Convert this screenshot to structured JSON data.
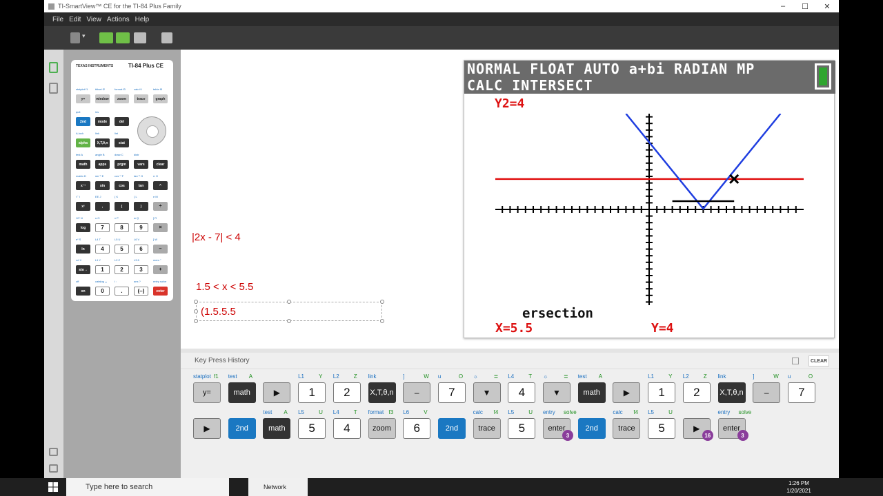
{
  "window": {
    "title": "TI-SmartView™ CE for the TI-84 Plus Family",
    "controls": [
      "–",
      "☐",
      "✕"
    ]
  },
  "menu": [
    "File",
    "Edit",
    "View",
    "Actions",
    "Help"
  ],
  "calculator": {
    "brand": "TEXAS INSTRUMENTS",
    "model": "TI-84 Plus CE",
    "rows": [
      [
        [
          "y=",
          "g"
        ],
        [
          "window",
          "g"
        ],
        [
          "zoom",
          "g"
        ],
        [
          "trace",
          "g"
        ],
        [
          "graph",
          "g"
        ]
      ],
      [
        [
          "2nd",
          "b"
        ],
        [
          "mode",
          "d"
        ],
        [
          "del",
          "d"
        ]
      ],
      [
        [
          "alpha",
          "gr"
        ],
        [
          "X,T,θ,n",
          "d"
        ],
        [
          "stat",
          "d"
        ]
      ],
      [
        [
          "math",
          "d"
        ],
        [
          "apps",
          "d"
        ],
        [
          "prgm",
          "d"
        ],
        [
          "vars",
          "d"
        ],
        [
          "clear",
          "d"
        ]
      ],
      [
        [
          "x⁻¹",
          "d"
        ],
        [
          "sin",
          "d"
        ],
        [
          "cos",
          "d"
        ],
        [
          "tan",
          "d"
        ],
        [
          "^",
          "d"
        ]
      ],
      [
        [
          "x²",
          "d"
        ],
        [
          ",",
          "d"
        ],
        [
          "(",
          "d"
        ],
        [
          ")",
          "d"
        ],
        [
          "÷",
          "mg"
        ]
      ],
      [
        [
          "log",
          "d"
        ],
        [
          "7",
          "w"
        ],
        [
          "8",
          "w"
        ],
        [
          "9",
          "w"
        ],
        [
          "×",
          "mg"
        ]
      ],
      [
        [
          "ln",
          "d"
        ],
        [
          "4",
          "w"
        ],
        [
          "5",
          "w"
        ],
        [
          "6",
          "w"
        ],
        [
          "–",
          "mg"
        ]
      ],
      [
        [
          "sto→",
          "d"
        ],
        [
          "1",
          "w"
        ],
        [
          "2",
          "w"
        ],
        [
          "3",
          "w"
        ],
        [
          "+",
          "mg"
        ]
      ],
      [
        [
          "on",
          "d"
        ],
        [
          "0",
          "w"
        ],
        [
          ".",
          "w"
        ],
        [
          "(–)",
          "w"
        ],
        [
          "enter",
          "r"
        ]
      ]
    ],
    "labels": [
      "statplot f1",
      "tblset f2",
      "format f3",
      "calc f4",
      "table f5",
      "quit",
      "ins",
      "A-lock",
      "link",
      "list",
      "test A",
      "angle B",
      "draw C",
      "distr",
      "matrix D",
      "sin⁻¹ E",
      "cos⁻¹ F",
      "tan⁻¹ G",
      "π H",
      "√‾ I",
      "EE J",
      "{ K",
      "} L",
      "e M",
      "10ˣ N",
      "u O",
      "v P",
      "w Q",
      "[ R",
      "eˣ S",
      "L4 T",
      "L5 U",
      "L6 V",
      "] W",
      "rcl X",
      "L1 Y",
      "L2 Z",
      "L3 θ",
      "mem \"",
      "off",
      "catalog ⌴",
      "i :",
      "ans ?",
      "entry solve"
    ]
  },
  "screen": {
    "line1": "NORMAL FLOAT AUTO a+bi RADIAN MP",
    "line2": "CALC INTERSECT",
    "y2": "Y2=4",
    "intersection": "ersection",
    "x": "X=5.5",
    "y": "Y=4"
  },
  "graph_colors": {
    "absolute_line": "#1f3ee0",
    "constant_line": "#e01010",
    "axes": "#000000"
  },
  "notes": {
    "inequality": "|2x - 7| < 4",
    "solution": "1.5 < x < 5.5",
    "textbox": "(1.5.5.5"
  },
  "history": {
    "title": "Key Press History",
    "clear": "CLEAR",
    "row1": [
      {
        "key": "y=",
        "t": "g",
        "top": "statplot",
        "topr": "f1"
      },
      {
        "key": "math",
        "t": "d",
        "top": "test",
        "topr": "A"
      },
      {
        "key": "▶",
        "t": "a",
        "top": "",
        "topr": ""
      },
      {
        "key": "1",
        "t": "w",
        "top": "L1",
        "topr": "Y"
      },
      {
        "key": "2",
        "t": "w",
        "top": "L2",
        "topr": "Z"
      },
      {
        "key": "X,T,θ,n",
        "t": "d",
        "top": "link",
        "topr": ""
      },
      {
        "key": "–",
        "t": "a",
        "top": "]",
        "topr": "W"
      },
      {
        "key": "7",
        "t": "w",
        "top": "u",
        "topr": "O"
      },
      {
        "key": "▼",
        "t": "a",
        "top": "☼",
        "topr": "≣"
      },
      {
        "key": "4",
        "t": "w",
        "top": "L4",
        "topr": "T"
      },
      {
        "key": "▼",
        "t": "a",
        "top": "☼",
        "topr": "≣"
      },
      {
        "key": "math",
        "t": "d",
        "top": "test",
        "topr": "A"
      },
      {
        "key": "▶",
        "t": "a",
        "top": "",
        "topr": ""
      },
      {
        "key": "1",
        "t": "w",
        "top": "L1",
        "topr": "Y"
      },
      {
        "key": "2",
        "t": "w",
        "top": "L2",
        "topr": "Z"
      },
      {
        "key": "X,T,θ,n",
        "t": "d",
        "top": "link",
        "topr": ""
      },
      {
        "key": "–",
        "t": "a",
        "top": "]",
        "topr": "W"
      },
      {
        "key": "7",
        "t": "w",
        "top": "u",
        "topr": "O"
      }
    ],
    "row2": [
      {
        "key": "▶",
        "t": "a",
        "top": "",
        "topr": ""
      },
      {
        "key": "2nd",
        "t": "b",
        "top": "",
        "topr": ""
      },
      {
        "key": "math",
        "t": "d",
        "top": "test",
        "topr": "A"
      },
      {
        "key": "5",
        "t": "w",
        "top": "L5",
        "topr": "U"
      },
      {
        "key": "4",
        "t": "w",
        "top": "L4",
        "topr": "T"
      },
      {
        "key": "zoom",
        "t": "g",
        "top": "format",
        "topr": "f3"
      },
      {
        "key": "6",
        "t": "w",
        "top": "L6",
        "topr": "V"
      },
      {
        "key": "2nd",
        "t": "b",
        "top": "",
        "topr": ""
      },
      {
        "key": "trace",
        "t": "g",
        "top": "calc",
        "topr": "f4"
      },
      {
        "key": "5",
        "t": "w",
        "top": "L5",
        "topr": "U"
      },
      {
        "key": "enter",
        "t": "g",
        "top": "entry",
        "topr": "solve",
        "badge": "3"
      },
      {
        "key": "2nd",
        "t": "b",
        "top": "",
        "topr": ""
      },
      {
        "key": "trace",
        "t": "g",
        "top": "calc",
        "topr": "f4"
      },
      {
        "key": "5",
        "t": "w",
        "top": "L5",
        "topr": "U"
      },
      {
        "key": "▶",
        "t": "a",
        "top": "",
        "topr": "",
        "badge": "16"
      },
      {
        "key": "enter",
        "t": "g",
        "top": "entry",
        "topr": "solve",
        "badge": "3"
      }
    ]
  },
  "taskbar": {
    "search_placeholder": "Type here to search",
    "network": "Network",
    "time": "1:26 PM",
    "date": "1/20/2021"
  }
}
